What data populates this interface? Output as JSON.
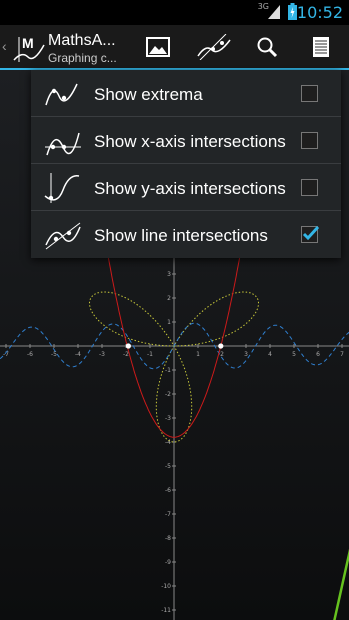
{
  "status_bar": {
    "time": "10:52",
    "network": "3G"
  },
  "action_bar": {
    "title": "MathsA...",
    "subtitle": "Graphing c...",
    "actions": [
      "image-icon",
      "curve-icon",
      "search-icon",
      "menu-icon"
    ]
  },
  "menu": {
    "items": [
      {
        "label": "Show extrema",
        "checked": false,
        "icon": "extrema-icon"
      },
      {
        "label": "Show x-axis intersections",
        "checked": false,
        "icon": "x-intersections-icon"
      },
      {
        "label": "Show y-axis intersections",
        "checked": false,
        "icon": "y-intersections-icon"
      },
      {
        "label": "Show line intersections",
        "checked": true,
        "icon": "line-intersections-icon"
      }
    ]
  },
  "graph": {
    "x_ticks": [
      "-7",
      "-6",
      "-5",
      "-4",
      "-3",
      "-2",
      "-1",
      "1",
      "2",
      "3",
      "4",
      "5",
      "6",
      "7"
    ],
    "y_ticks": [
      "3",
      "2",
      "1",
      "-1",
      "-2",
      "-3",
      "-4",
      "-5",
      "-6",
      "-7",
      "-8",
      "-9",
      "-10",
      "-11"
    ],
    "colors": {
      "parabola": "#cc1a1a",
      "wave": "#2f7fcf",
      "rose": "#c8c83a",
      "line": "#66c21f",
      "accent": "#33b5e5"
    }
  }
}
